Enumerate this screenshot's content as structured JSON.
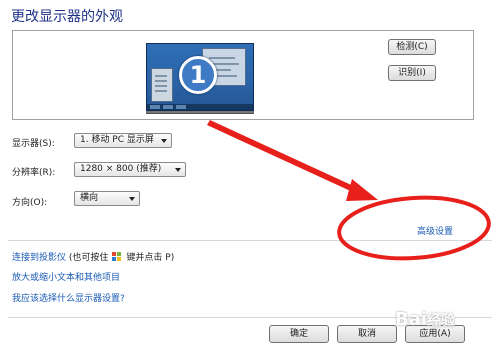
{
  "page": {
    "title": "更改显示器的外观"
  },
  "preview": {
    "monitor_number": "1",
    "detect_label": "检测(C)",
    "identify_label": "识别(I)"
  },
  "settings": {
    "display_label": "显示器(S):",
    "display_value": "1. 移动 PC 显示屏",
    "resolution_label": "分辨率(R):",
    "resolution_value": "1280 × 800 (推荐)",
    "orientation_label": "方向(O):",
    "orientation_value": "横向"
  },
  "advanced_link": "高级设置",
  "links": {
    "projector_prefix": "连接到投影仪",
    "projector_hint_before": "(也可按住",
    "projector_hint_after": "键并点击 P)",
    "text_size": "放大或缩小文本和其他项目",
    "which_settings": "我应该选择什么显示器设置?"
  },
  "footer": {
    "ok_label": "确定",
    "cancel_label": "取消",
    "apply_label": "应用(A)"
  },
  "annotation": {
    "color": "#e8201c"
  },
  "watermark": {
    "text": "Baidu 经验"
  }
}
